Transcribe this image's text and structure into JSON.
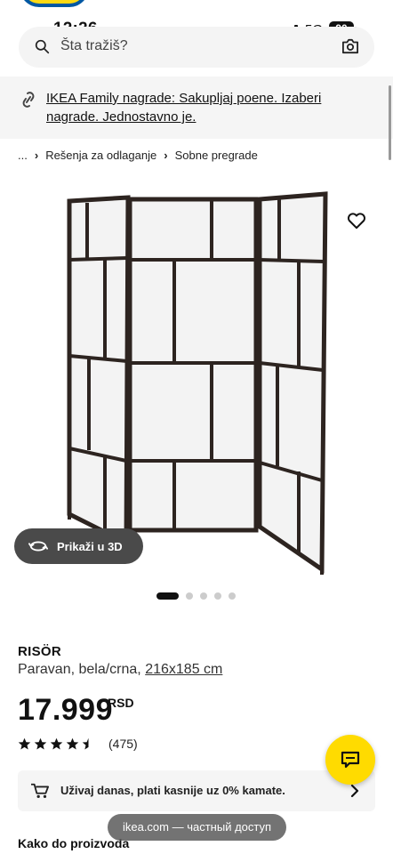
{
  "status_bar": {
    "time": "12:26",
    "network": "5G",
    "battery": "90"
  },
  "search": {
    "placeholder": "Šta tražiš?"
  },
  "promo": {
    "text": "IKEA Family nagrade: Sakupljaj poene. Izaberi nagrade. Jednostavno je."
  },
  "breadcrumb": {
    "root": "...",
    "items": [
      "Rešenja za odlaganje",
      "Sobne pregrade"
    ]
  },
  "view3d": {
    "label": "Prikaži u 3D"
  },
  "carousel": {
    "count": 5,
    "active_index": 0
  },
  "product": {
    "name": "RISÖR",
    "description_prefix": "Paravan, bela/crna, ",
    "dimensions": "216x185 cm",
    "price": "17.999",
    "currency": "RSD",
    "rating_value": 4.5,
    "rating_count": "(475)"
  },
  "finance": {
    "text": "Uživaj danas, plati kasnije uz 0% kamate."
  },
  "safari": {
    "text": "ikea.com — частный доступ"
  },
  "section": {
    "heading": "Kako do proizvoda"
  },
  "colors": {
    "ikea_yellow": "#ffdb00",
    "ikea_blue": "#0058a3",
    "frame": "#2d2420",
    "panel": "#f3f3f3"
  }
}
